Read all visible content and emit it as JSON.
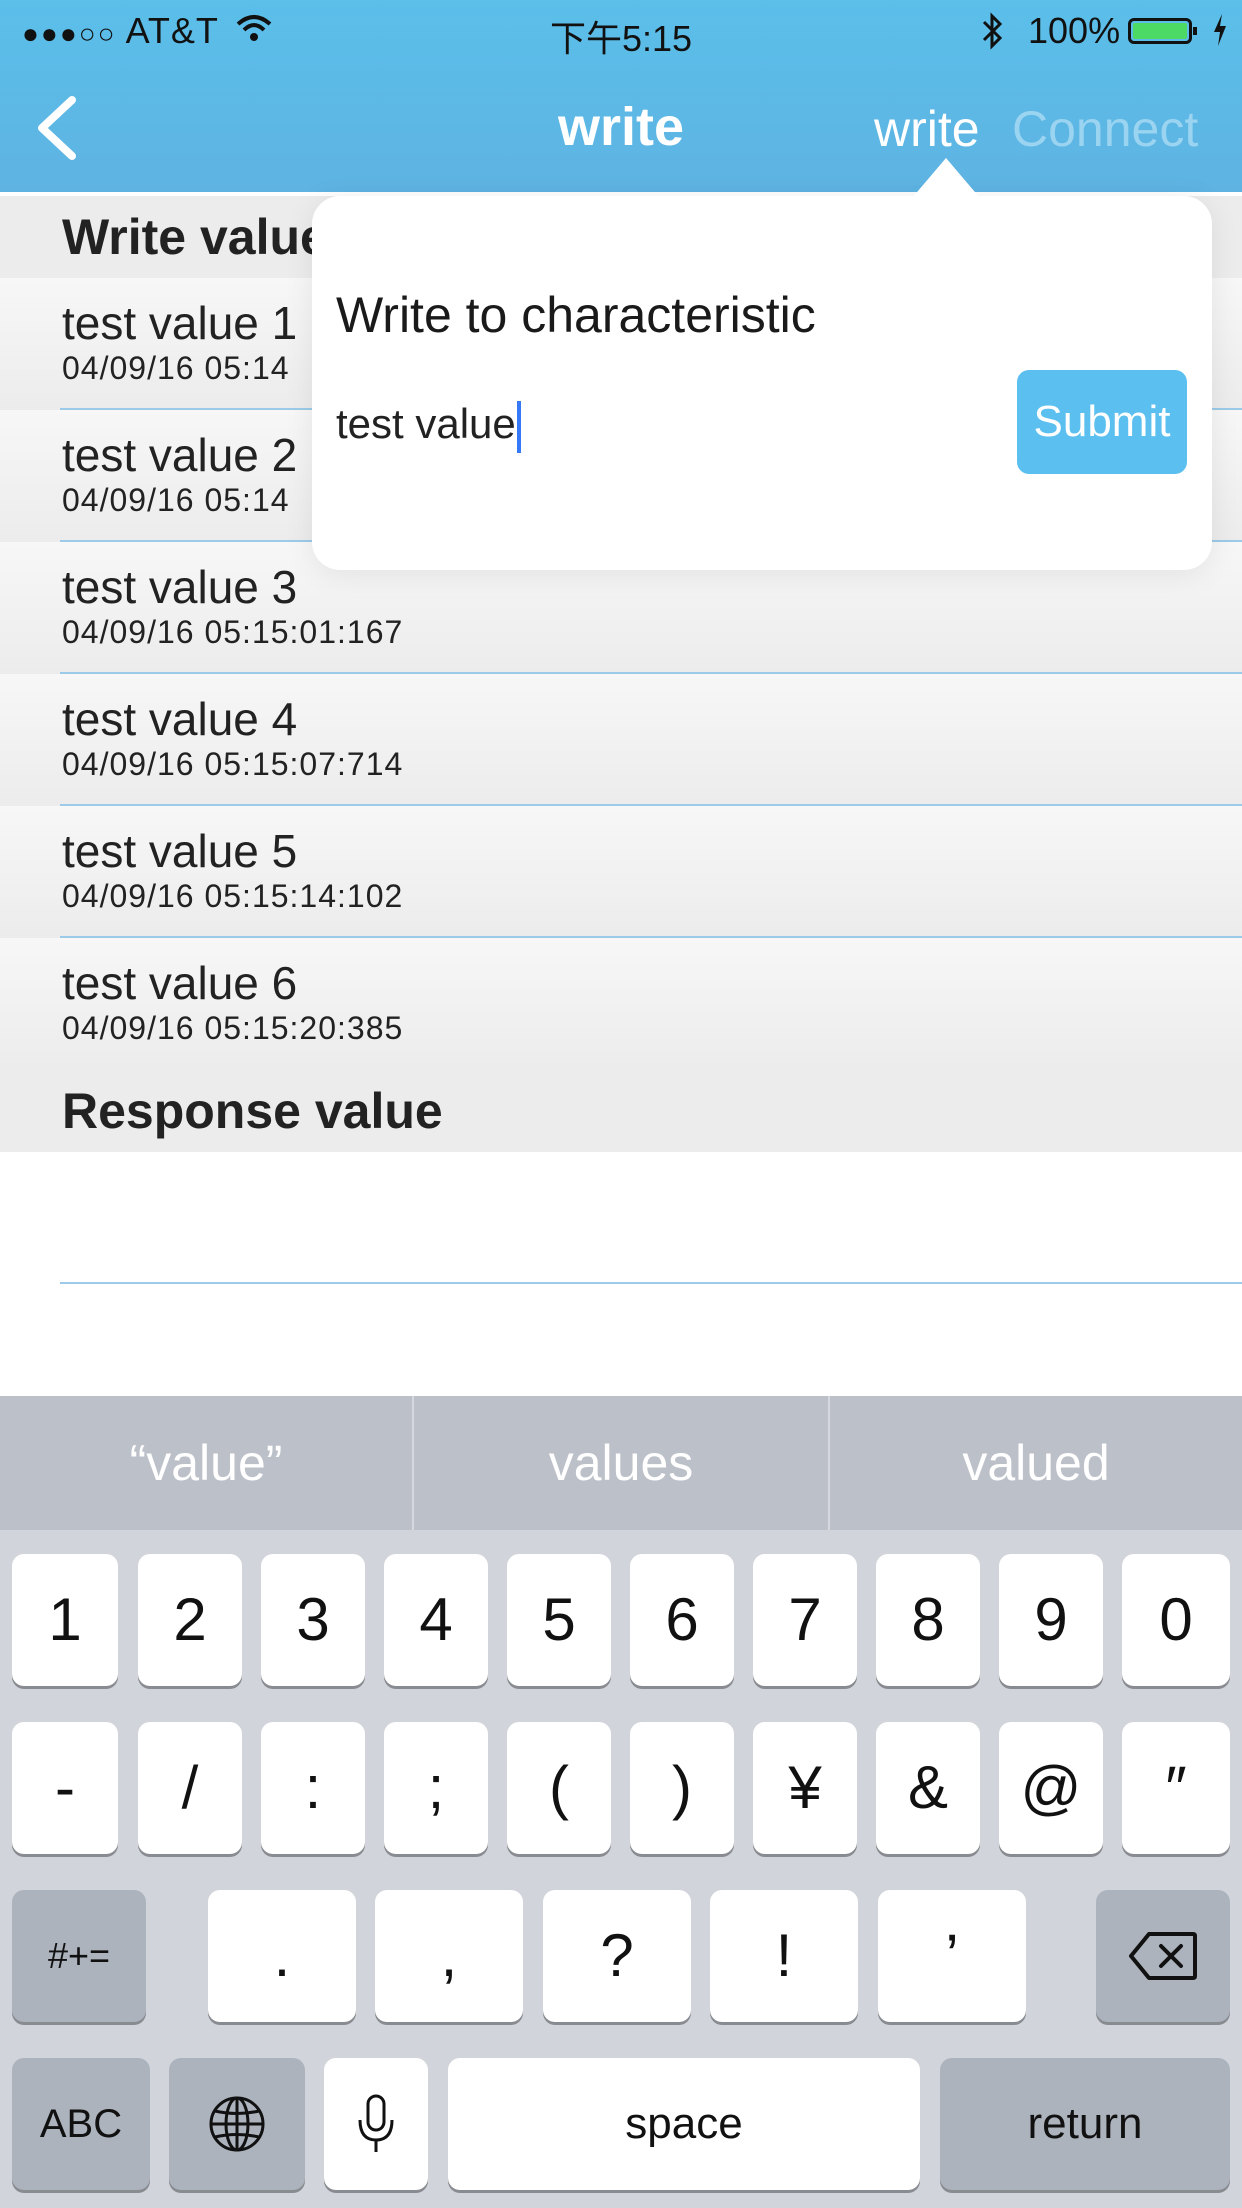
{
  "status_bar": {
    "signal": "●●●○○",
    "carrier": "AT&T",
    "time": "下午5:15",
    "battery_percent": "100%",
    "battery_level": 1.0
  },
  "nav": {
    "back_icon": "chevron-left-icon",
    "title": "write",
    "segment_write": "write",
    "segment_connect": "Connect"
  },
  "write_section": {
    "header": "Write value",
    "items": [
      {
        "value": "test value 1",
        "timestamp": "04/09/16 05:14"
      },
      {
        "value": "test value 2",
        "timestamp": "04/09/16 05:14"
      },
      {
        "value": "test value 3",
        "timestamp": "04/09/16 05:15:01:167"
      },
      {
        "value": "test value 4",
        "timestamp": "04/09/16 05:15:07:714"
      },
      {
        "value": "test value 5",
        "timestamp": "04/09/16 05:15:14:102"
      },
      {
        "value": "test value 6",
        "timestamp": "04/09/16 05:15:20:385"
      }
    ]
  },
  "response_section": {
    "header": "Response value"
  },
  "popover": {
    "title": "Write to characteristic",
    "input_value": "test value",
    "submit_label": "Submit"
  },
  "keyboard": {
    "suggestions": [
      "“value”",
      "values",
      "valued"
    ],
    "row1": [
      "1",
      "2",
      "3",
      "4",
      "5",
      "6",
      "7",
      "8",
      "9",
      "0"
    ],
    "row2": [
      "-",
      "/",
      ":",
      ";",
      "(",
      ")",
      "¥",
      "&",
      "@",
      "″"
    ],
    "row3_left": "#+=",
    "row3": [
      ".",
      ",",
      "?",
      "!",
      "’"
    ],
    "row3_right_icon": "backspace-icon",
    "abc": "ABC",
    "globe_icon": "globe-icon",
    "mic_icon": "microphone-icon",
    "space": "space",
    "return": "return"
  }
}
